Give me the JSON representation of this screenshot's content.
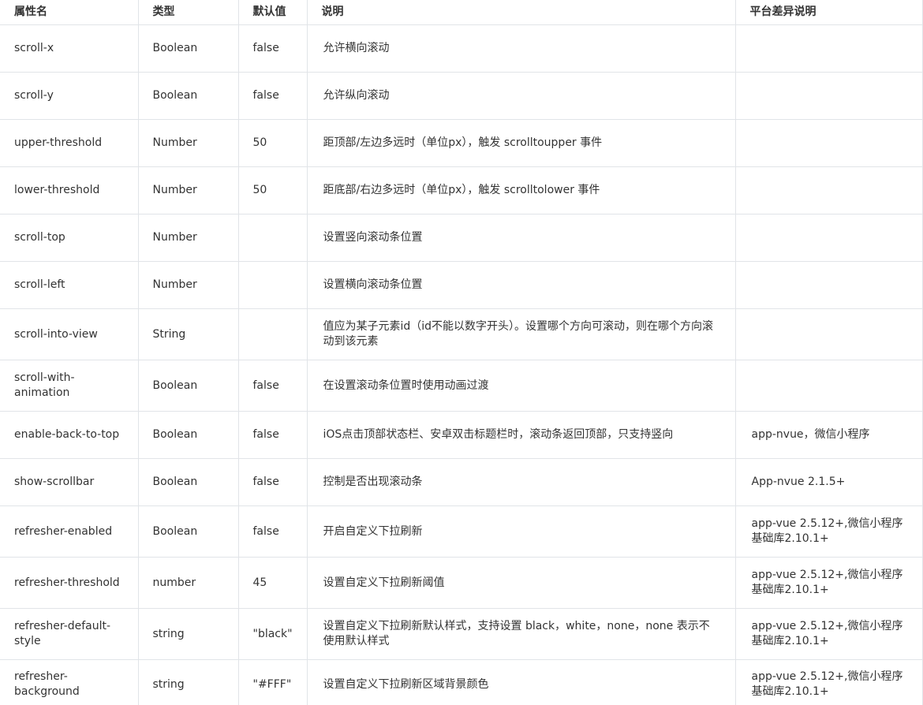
{
  "table": {
    "headers": [
      "属性名",
      "类型",
      "默认值",
      "说明",
      "平台差异说明"
    ],
    "rows": [
      {
        "name": "scroll-x",
        "type": "Boolean",
        "default": "false",
        "desc": "允许横向滚动",
        "platform": ""
      },
      {
        "name": "scroll-y",
        "type": "Boolean",
        "default": "false",
        "desc": "允许纵向滚动",
        "platform": ""
      },
      {
        "name": "upper-threshold",
        "type": "Number",
        "default": "50",
        "desc": "距顶部/左边多远时（单位px），触发 scrolltoupper 事件",
        "platform": ""
      },
      {
        "name": "lower-threshold",
        "type": "Number",
        "default": "50",
        "desc": "距底部/右边多远时（单位px），触发 scrolltolower 事件",
        "platform": ""
      },
      {
        "name": "scroll-top",
        "type": "Number",
        "default": "",
        "desc": "设置竖向滚动条位置",
        "platform": ""
      },
      {
        "name": "scroll-left",
        "type": "Number",
        "default": "",
        "desc": "设置横向滚动条位置",
        "platform": ""
      },
      {
        "name": "scroll-into-view",
        "type": "String",
        "default": "",
        "desc": "值应为某子元素id（id不能以数字开头）。设置哪个方向可滚动，则在哪个方向滚动到该元素",
        "platform": ""
      },
      {
        "name": "scroll-with-animation",
        "type": "Boolean",
        "default": "false",
        "desc": "在设置滚动条位置时使用动画过渡",
        "platform": ""
      },
      {
        "name": "enable-back-to-top",
        "type": "Boolean",
        "default": "false",
        "desc": "iOS点击顶部状态栏、安卓双击标题栏时，滚动条返回顶部，只支持竖向",
        "platform": "app-nvue，微信小程序"
      },
      {
        "name": "show-scrollbar",
        "type": "Boolean",
        "default": "false",
        "desc": "控制是否出现滚动条",
        "platform": "App-nvue 2.1.5+"
      },
      {
        "name": "refresher-enabled",
        "type": "Boolean",
        "default": "false",
        "desc": "开启自定义下拉刷新",
        "platform": "app-vue 2.5.12+,微信小程序基础库2.10.1+"
      },
      {
        "name": "refresher-threshold",
        "type": "number",
        "default": "45",
        "desc": "设置自定义下拉刷新阈值",
        "platform": "app-vue 2.5.12+,微信小程序基础库2.10.1+"
      },
      {
        "name": "refresher-default-style",
        "type": "string",
        "default": "\"black\"",
        "desc": "设置自定义下拉刷新默认样式，支持设置 black，white，none，none 表示不使用默认样式",
        "platform": "app-vue 2.5.12+,微信小程序基础库2.10.1+"
      },
      {
        "name": "refresher-background",
        "type": "string",
        "default": "\"#FFF\"",
        "desc": "设置自定义下拉刷新区域背景颜色",
        "platform": "app-vue 2.5.12+,微信小程序基础库2.10.1+"
      }
    ]
  },
  "colors": {
    "text": "#333333",
    "border": "#e1e4e8",
    "background": "#ffffff"
  }
}
